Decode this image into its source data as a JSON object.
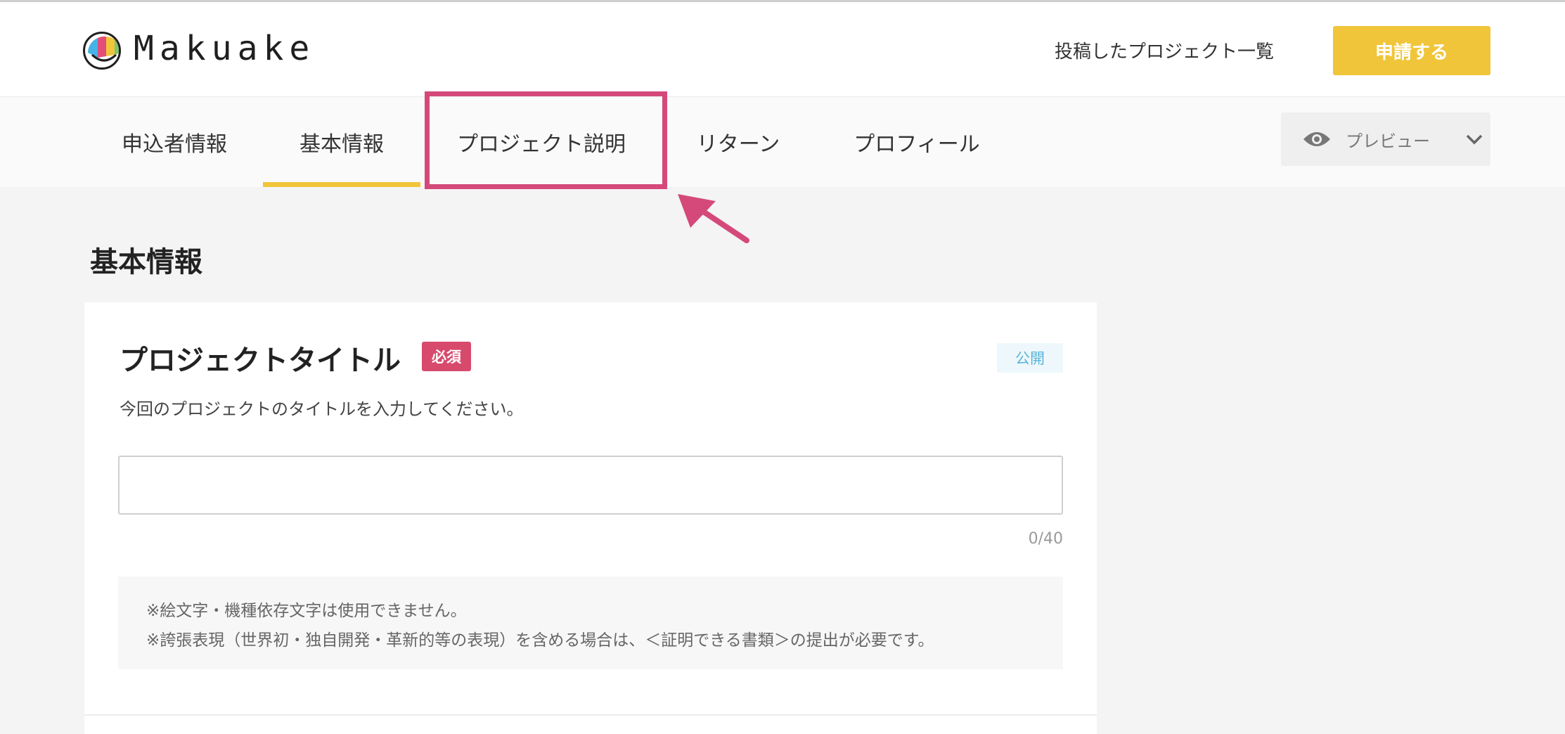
{
  "header": {
    "brand": "Makuake",
    "projects_link": "投稿したプロジェクト一覧",
    "apply_button": "申請する"
  },
  "tabs": [
    {
      "label": "申込者情報",
      "active": false
    },
    {
      "label": "基本情報",
      "active": true
    },
    {
      "label": "プロジェクト説明",
      "active": false,
      "highlighted": true
    },
    {
      "label": "リターン",
      "active": false
    },
    {
      "label": "プロフィール",
      "active": false
    }
  ],
  "preview": {
    "label": "プレビュー",
    "icon": "eye-icon"
  },
  "main": {
    "section_title": "基本情報",
    "field": {
      "title": "プロジェクトタイトル",
      "required_badge": "必須",
      "visibility_badge": "公開",
      "description": "今回のプロジェクトのタイトルを入力してください。",
      "value": "",
      "placeholder": "",
      "counter": "0/40"
    },
    "notes": [
      "※絵文字・機種依存文字は使用できません。",
      "※誇張表現（世界初・独自開発・革新的等の表現）を含める場合は、＜証明できる書類＞の提出が必要です。"
    ]
  },
  "colors": {
    "accent_yellow": "#f0c539",
    "highlight_pink": "#d4497a",
    "required_red": "#d74a6c",
    "public_blue": "#5ab4d9"
  }
}
